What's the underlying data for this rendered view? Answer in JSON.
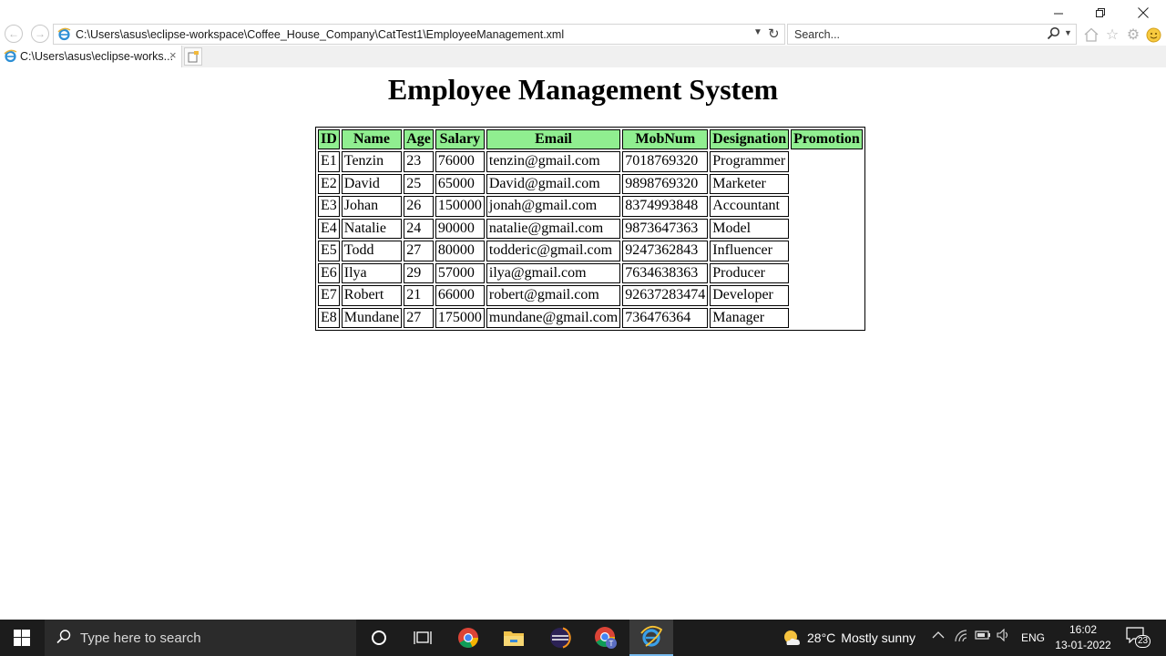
{
  "browser": {
    "address": "C:\\Users\\asus\\eclipse-workspace\\Coffee_House_Company\\CatTest1\\EmployeeManagement.xml",
    "search_placeholder": "Search...",
    "tab_title": "C:\\Users\\asus\\eclipse-works...",
    "tab_close": "×",
    "icons": [
      "back-icon",
      "forward-icon",
      "ie-icon",
      "refresh-icon",
      "search-icon",
      "home-icon",
      "star-icon",
      "gear-icon",
      "smiley-icon"
    ]
  },
  "page": {
    "title": "Employee Management System",
    "table": {
      "headers": [
        "ID",
        "Name",
        "Age",
        "Salary",
        "Email",
        "MobNum",
        "Designation",
        "Promotion"
      ],
      "rows": [
        [
          "E1",
          "Tenzin",
          "23",
          "76000",
          "tenzin@gmail.com",
          "7018769320",
          "Programmer"
        ],
        [
          "E2",
          "David",
          "25",
          "65000",
          "David@gmail.com",
          "9898769320",
          "Marketer"
        ],
        [
          "E3",
          "Johan",
          "26",
          "150000",
          "jonah@gmail.com",
          "8374993848",
          "Accountant"
        ],
        [
          "E4",
          "Natalie",
          "24",
          "90000",
          "natalie@gmail.com",
          "9873647363",
          "Model"
        ],
        [
          "E5",
          "Todd",
          "27",
          "80000",
          "todderic@gmail.com",
          "9247362843",
          "Influencer"
        ],
        [
          "E6",
          "Ilya",
          "29",
          "57000",
          "ilya@gmail.com",
          "7634638363",
          "Producer"
        ],
        [
          "E7",
          "Robert",
          "21",
          "66000",
          "robert@gmail.com",
          "92637283474",
          "Developer"
        ],
        [
          "E8",
          "Mundane",
          "27",
          "175000",
          "mundane@gmail.com",
          "736476364",
          "Manager"
        ]
      ],
      "header_color": "#90ee90"
    }
  },
  "taskbar": {
    "search_placeholder": "Type here to search",
    "weather": {
      "temp": "28°C",
      "condition": "Mostly sunny"
    },
    "language": "ENG",
    "time": "16:02",
    "date": "13-01-2022",
    "notification_count": "23",
    "apps": [
      "cortana-icon",
      "task-view-icon",
      "chrome-icon",
      "file-explorer-icon",
      "eclipse-icon",
      "chrome-profile-icon",
      "internet-explorer-icon"
    ]
  }
}
